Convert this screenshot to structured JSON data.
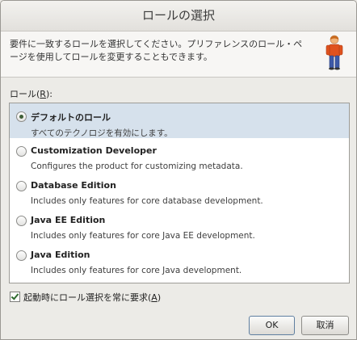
{
  "dialog": {
    "title": "ロールの選択",
    "message": "要件に一致するロールを選択してください。プリファレンスのロール・ページを使用してロールを変更することもできます。",
    "roles_label_prefix": "ロール(",
    "roles_label_mnemonic": "R",
    "roles_label_suffix": "):",
    "roles": [
      {
        "title": "デフォルトのロール",
        "description": "すべてのテクノロジを有効にします。",
        "selected": true
      },
      {
        "title": "Customization Developer",
        "description": "Configures the product for customizing metadata.",
        "selected": false
      },
      {
        "title": "Database Edition",
        "description": "Includes only features for core database development.",
        "selected": false
      },
      {
        "title": "Java EE Edition",
        "description": "Includes only features for core Java EE development.",
        "selected": false
      },
      {
        "title": "Java Edition",
        "description": "Includes only features for core Java development.",
        "selected": false
      }
    ],
    "always_prompt": {
      "checked": true,
      "label_prefix": "起動時にロール選択を常に要求(",
      "label_mnemonic": "A",
      "label_suffix": ")"
    },
    "ok_label": "OK",
    "cancel_label": "取消"
  },
  "icons": {
    "role": "person-icon"
  },
  "colors": {
    "selected_row": "#d6e1ec",
    "window_bg": "#ecebe7"
  }
}
